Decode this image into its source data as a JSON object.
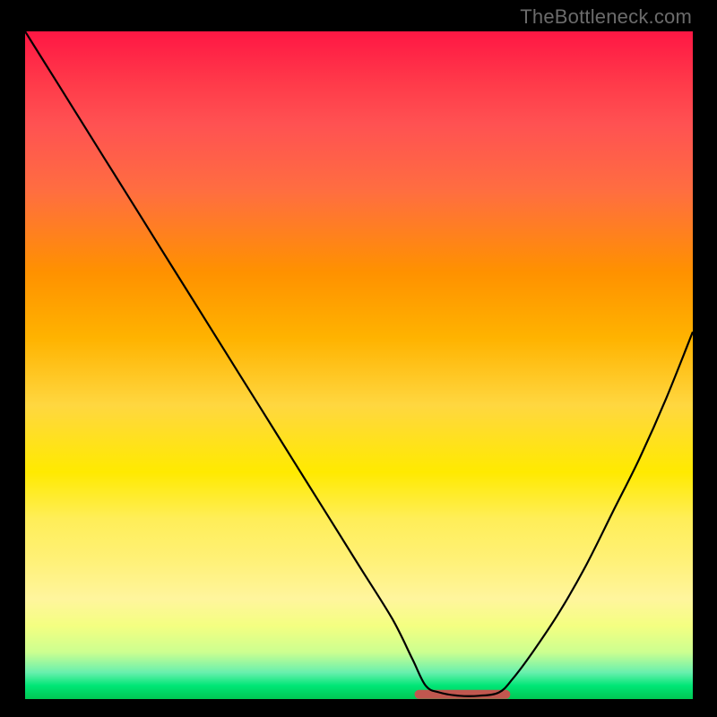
{
  "watermark": "TheBottleneck.com",
  "colors": {
    "background": "#000000",
    "curve": "#000000",
    "highlight_segment": "#c1574f",
    "gradient_top": "#ff1744",
    "gradient_bottom": "#00c853"
  },
  "chart_data": {
    "type": "line",
    "title": "",
    "xlabel": "",
    "ylabel": "",
    "xlim": [
      0,
      100
    ],
    "ylim": [
      0,
      100
    ],
    "grid": false,
    "legend": false,
    "annotations": [],
    "description": "V-shaped bottleneck curve over a vertical red-to-green gradient. Y represents bottleneck percentage (100 at top = red/bad, 0 at bottom = green/good). The curve reaches its minimum (near 0) around x≈60-71, highlighted with a short brownish-red segment along the bottom.",
    "series": [
      {
        "name": "bottleneck-curve",
        "x": [
          0,
          5,
          10,
          15,
          20,
          25,
          30,
          35,
          40,
          45,
          50,
          55,
          58,
          60,
          62,
          65,
          68,
          71,
          73,
          76,
          80,
          84,
          88,
          92,
          96,
          100
        ],
        "y": [
          100,
          92,
          84,
          76,
          68,
          60,
          52,
          44,
          36,
          28,
          20,
          12,
          6,
          2,
          1,
          0.5,
          0.5,
          1,
          3,
          7,
          13,
          20,
          28,
          36,
          45,
          55
        ]
      },
      {
        "name": "optimal-range-marker",
        "x": [
          59,
          72
        ],
        "y": [
          0.7,
          0.7
        ]
      }
    ]
  }
}
